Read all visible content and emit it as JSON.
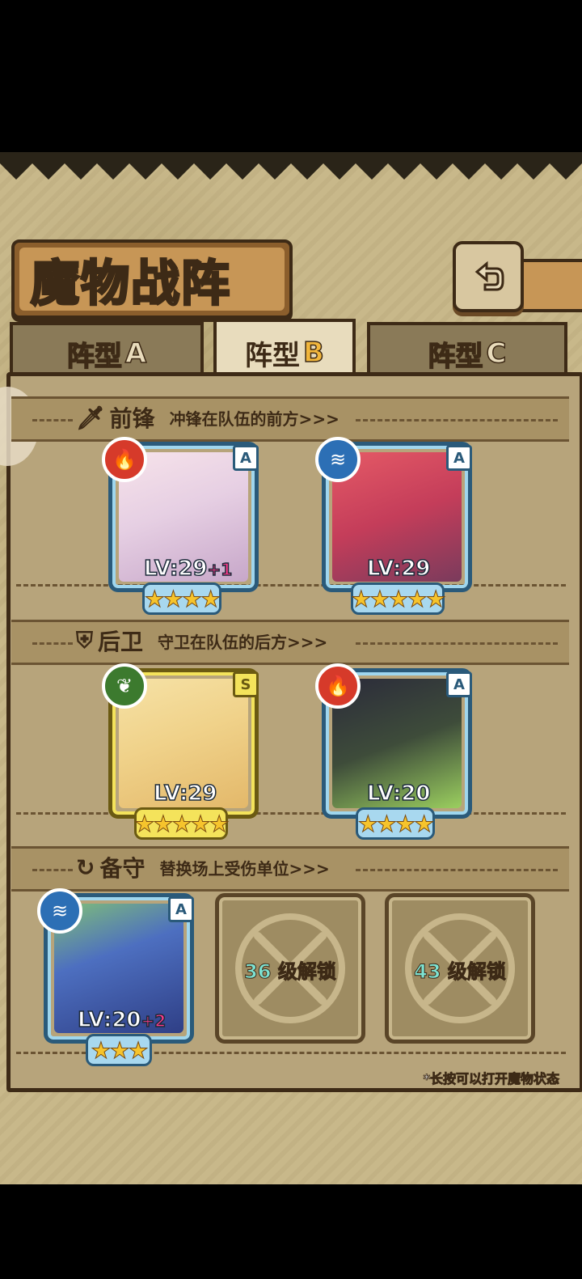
{
  "title": "魔物战阵",
  "tabs": [
    {
      "prefix": "阵型",
      "letter": "A",
      "active": false
    },
    {
      "prefix": "阵型",
      "letter": "B",
      "active": true
    },
    {
      "prefix": "阵型",
      "letter": "C",
      "active": false
    }
  ],
  "sections": {
    "front": {
      "title": "前锋",
      "subtitle": "冲锋在队伍的前方>>>",
      "icon": "sword-icon"
    },
    "back": {
      "title": "后卫",
      "subtitle": "守卫在队伍的后方>>>",
      "icon": "shield-icon"
    },
    "reserve": {
      "title": "备守",
      "subtitle": "替换场上受伤单位>>>",
      "icon": "swap-icon"
    }
  },
  "front_units": [
    {
      "element": "fire",
      "rank": "A",
      "lv": "LV:29",
      "plus": "+1",
      "stars": "★★★★",
      "star_count": 4
    },
    {
      "element": "water",
      "rank": "A",
      "lv": "LV:29",
      "plus": "",
      "stars": "★★★★★",
      "star_count": 5
    }
  ],
  "back_units": [
    {
      "element": "nature",
      "rank": "S",
      "lv": "LV:29",
      "plus": "",
      "stars": "★★★★★",
      "star_count": 5
    },
    {
      "element": "fire",
      "rank": "A",
      "lv": "LV:20",
      "plus": "",
      "stars": "★★★★",
      "star_count": 4
    }
  ],
  "reserve_units": [
    {
      "element": "water",
      "rank": "A",
      "lv": "LV:20",
      "plus": "+2",
      "stars": "★★★",
      "star_count": 3
    }
  ],
  "locked_slots": [
    {
      "level": "36",
      "label": "级解锁"
    },
    {
      "level": "43",
      "label": "级解锁"
    }
  ],
  "hint": "*长按可以打开魔物状态",
  "colors": {
    "fire": "#d63a2a",
    "water": "#2c6fb5",
    "nature": "#3c7a2e"
  }
}
